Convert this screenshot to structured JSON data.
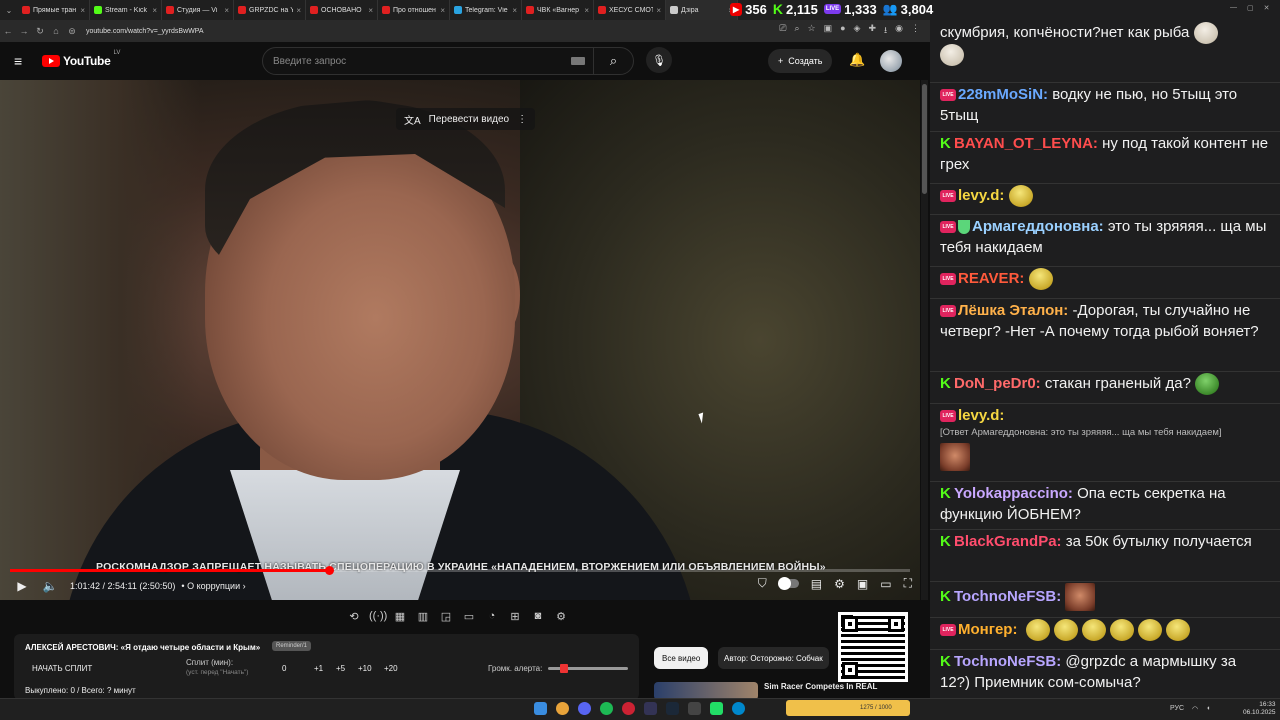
{
  "browser": {
    "tabs": [
      {
        "label": "Прямые тран",
        "color": "#e02020"
      },
      {
        "label": "Stream - Kick",
        "color": "#53fc18"
      },
      {
        "label": "Студия — Vi",
        "color": "#e02020"
      },
      {
        "label": "GRPZDC на Y",
        "color": "#e02020"
      },
      {
        "label": "ОСНОВАНО",
        "color": "#e02020"
      },
      {
        "label": "Про отношен",
        "color": "#e02020"
      },
      {
        "label": "Telegram: Vie",
        "color": "#2aa3e0"
      },
      {
        "label": "ЧВК «Вагнер",
        "color": "#e02020"
      },
      {
        "label": "ХЕСУС СМОТ",
        "color": "#e02020"
      },
      {
        "label": "Дзіра",
        "color": "#cccccc"
      }
    ],
    "url": "youtube.com/watch?v=_yyrdsBwWPA"
  },
  "stats": {
    "youtube_viewers": "356",
    "kick_viewers": "2,115",
    "vk_viewers": "1,333",
    "total_viewers": "3,804"
  },
  "youtube": {
    "logo_text": "YouTube",
    "region": "LV",
    "search_placeholder": "Введите запрос",
    "create_label": "Создать",
    "translate_label": "Перевести видео",
    "ticker": "РОСКОМНАДЗОР ЗАПРЕЩАЕТ НАЗЫВАТЬ СПЕЦОПЕРАЦИЮ В УКРАИНЕ «НАПАДЕНИЕМ, ВТОРЖЕНИЕМ ИЛИ ОБЪЯВЛЕНИЕМ ВОЙНЫ»",
    "time": "1:01:42 / 2:54:11 (2:50:50)",
    "chapter": "• О коррупции",
    "progress": 0.354
  },
  "panel": {
    "title": "АЛЕКСЕЙ АРЕСТОВИЧ: «Я отдаю четыре области и Крым»",
    "badge": "Reminder/1",
    "split_button": "НАЧАТЬ СПЛИТ",
    "split_label": "Сплит (мин):",
    "split_sub": "(уст. перед \"Начать\")",
    "values": [
      "0",
      "+1",
      "+5",
      "+10",
      "+20"
    ],
    "alert_label": "Громк. алерта:",
    "alert_volume": 0.15,
    "bought": "Выкуплено: 0 / Всего: ? минут"
  },
  "recommend": {
    "all_videos": "Все видео",
    "author": "Автор: Осторожно: Собчак",
    "video_title": "Sim Racer Competes In REAL"
  },
  "chat": {
    "top_text": "скумбрия, копчёности?нет как рыба",
    "messages": [
      {
        "platform": "vk",
        "nick": "228mMoSiN:",
        "color": "#6aa9ff",
        "text": "водку не пью, но 5тыщ это 5тыщ"
      },
      {
        "platform": "kick",
        "nick": "BAYAN_OT_LEYNA:",
        "color": "#ff4d4d",
        "text": "ну под такой контент не грех"
      },
      {
        "platform": "vk",
        "nick": "levy.d:",
        "color": "#f5d742",
        "text": ""
      },
      {
        "platform": "vk",
        "nick": "Армагеддоновна:",
        "color": "#9ad0ff",
        "text": "это ты зряяяя... ща мы тебя накидаем"
      },
      {
        "platform": "vk",
        "nick": "REAVER:",
        "color": "#ff5a3c",
        "text": ""
      },
      {
        "platform": "vk",
        "nick": "Лёшка Эталон:",
        "color": "#ffb14a",
        "text": "-Дорогая, ты случайно не четверг? -Нет -А почему тогда рыбой воняет?"
      },
      {
        "platform": "kick",
        "nick": "DoN_peDr0:",
        "color": "#ff6a6a",
        "text": "стакан граненый да?"
      },
      {
        "platform": "vk",
        "nick": "levy.d:",
        "color": "#f5d742",
        "reply": "[Ответ Армагеддоновна: это ты зряяяя... ща мы тебя накидаем]"
      },
      {
        "platform": "kick",
        "nick": "Yolokappaccino:",
        "color": "#c9a8ff",
        "text": "Опа есть секретка на функцию ЙОБНЕМ?"
      },
      {
        "platform": "kick",
        "nick": "BlackGrandPa:",
        "color": "#ff4d6d",
        "text": "за 50к бутылку получается"
      },
      {
        "platform": "kick",
        "nick": "TochnoNeFSB:",
        "color": "#b8a6ff",
        "text": ""
      },
      {
        "platform": "vk",
        "nick": "Монгер:",
        "color": "#ffb02e",
        "text": ""
      },
      {
        "platform": "kick",
        "nick": "TochnoNeFSB:",
        "color": "#b8a6ff",
        "text": "@grpzdc а мармышку за 12?) Приемник сом-сомыча?"
      }
    ]
  },
  "taskbar": {
    "media": "1275 / 1000",
    "lang": "РУС",
    "time": "16:33",
    "date": "06.10.2025"
  },
  "colors": {
    "accent_red": "#ff0000",
    "kick_green": "#53fc18",
    "vk_pink": "#e0245e",
    "chat_bg": "#1e1e1f"
  }
}
